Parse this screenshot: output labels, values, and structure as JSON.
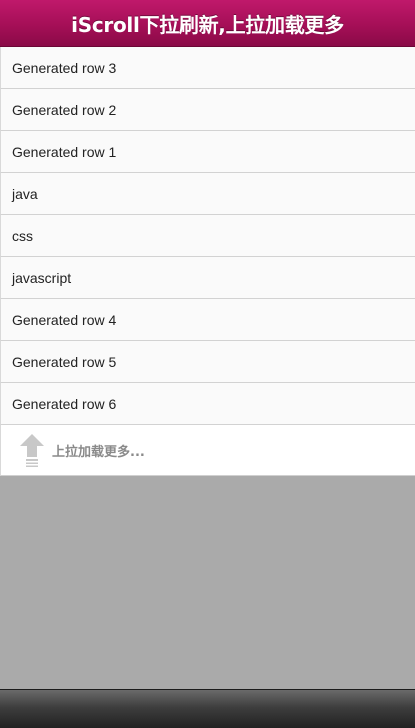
{
  "header": {
    "title": "iScroll下拉刷新,上拉加载更多"
  },
  "list": {
    "rows": [
      "Generated row 3",
      "Generated row 2",
      "Generated row 1",
      "java",
      "css",
      "javascript",
      "Generated row 4",
      "Generated row 5",
      "Generated row 6"
    ]
  },
  "pull_up": {
    "label": "上拉加载更多...",
    "icon": "up-arrow-icon"
  },
  "colors": {
    "header_accent": "#a50f57",
    "scroll_area_bg": "#aaaaaa",
    "footer_bg": "#3e3e3e"
  }
}
